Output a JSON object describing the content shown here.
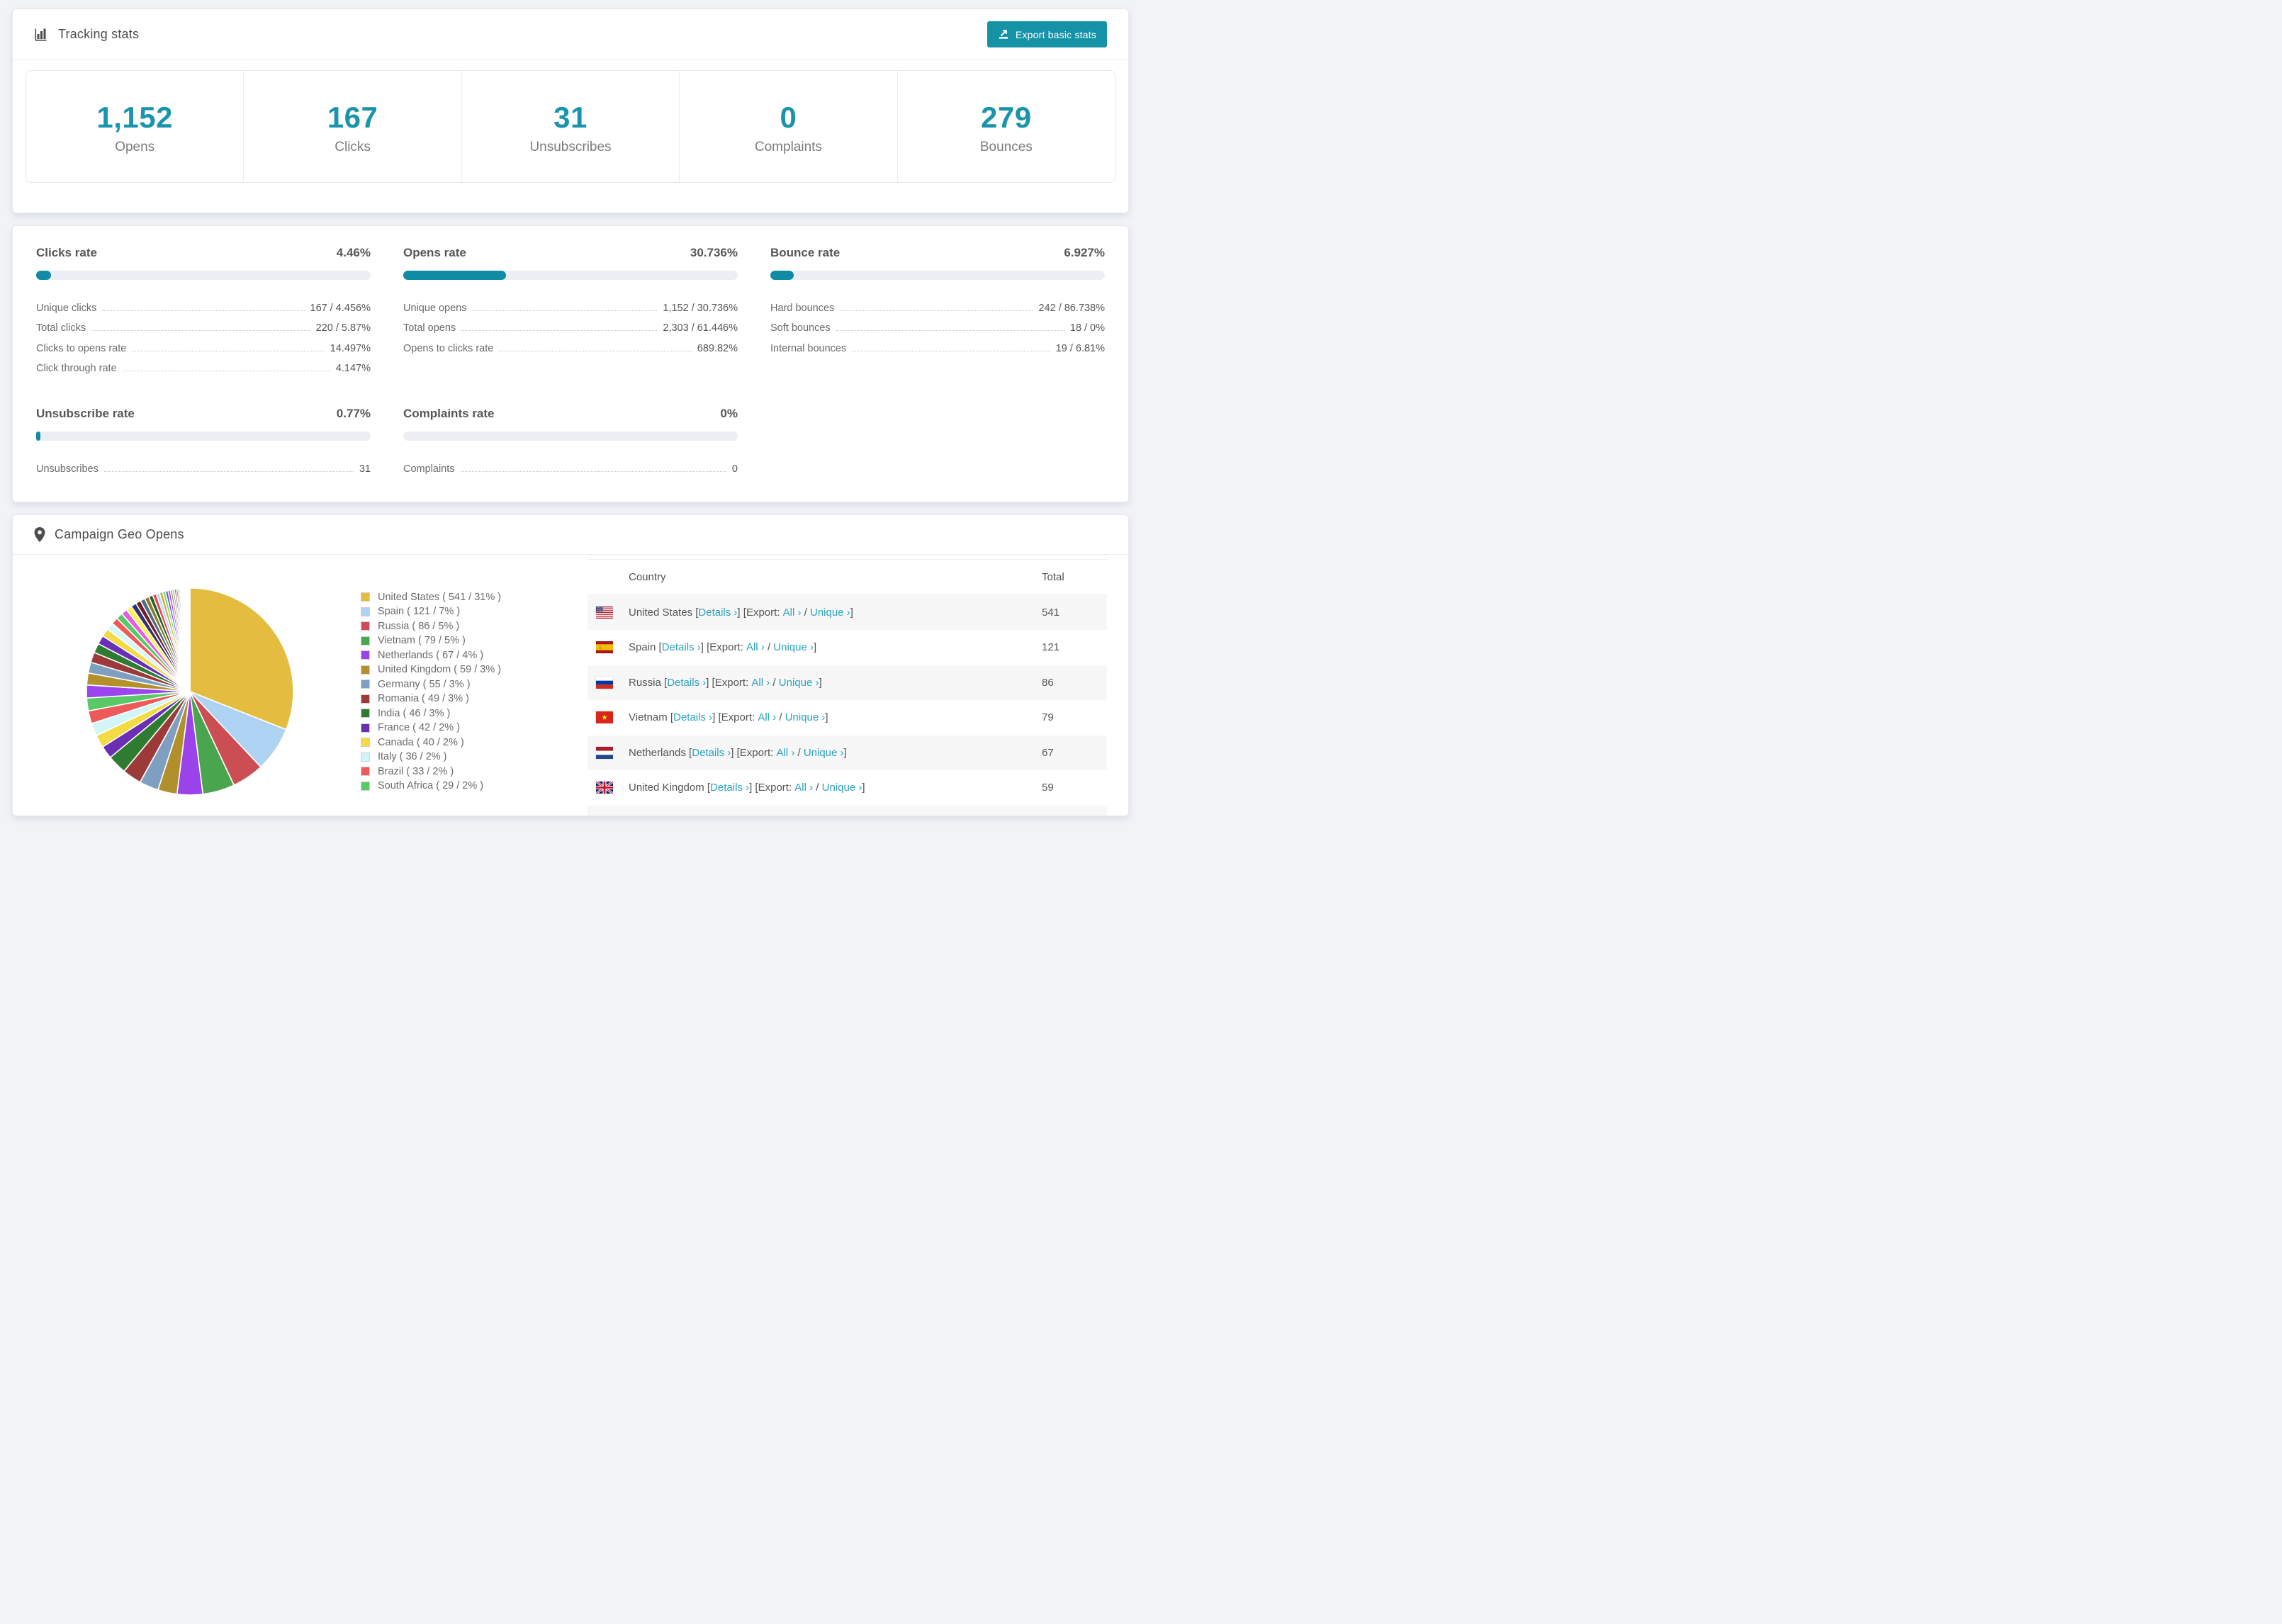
{
  "tracking": {
    "title": "Tracking stats",
    "export_label": "Export basic stats",
    "stats": [
      {
        "value": "1,152",
        "label": "Opens"
      },
      {
        "value": "167",
        "label": "Clicks"
      },
      {
        "value": "31",
        "label": "Unsubscribes"
      },
      {
        "value": "0",
        "label": "Complaints"
      },
      {
        "value": "279",
        "label": "Bounces"
      }
    ]
  },
  "rates": {
    "blocks": [
      {
        "title": "Clicks rate",
        "value": "4.46%",
        "pct": 4.46,
        "rows": [
          [
            "Unique clicks",
            "167 / 4.456%"
          ],
          [
            "Total clicks",
            "220 / 5.87%"
          ],
          [
            "Clicks to opens rate",
            "14.497%"
          ],
          [
            "Click through rate",
            "4.147%"
          ]
        ]
      },
      {
        "title": "Opens rate",
        "value": "30.736%",
        "pct": 30.736,
        "rows": [
          [
            "Unique opens",
            "1,152 / 30.736%"
          ],
          [
            "Total opens",
            "2,303 / 61.446%"
          ],
          [
            "Opens to clicks rate",
            "689.82%"
          ]
        ]
      },
      {
        "title": "Bounce rate",
        "value": "6.927%",
        "pct": 6.927,
        "rows": [
          [
            "Hard bounces",
            "242 / 86.738%"
          ],
          [
            "Soft bounces",
            "18 / 0%"
          ],
          [
            "Internal bounces",
            "19 / 6.81%"
          ]
        ]
      },
      {
        "title": "Unsubscribe rate",
        "value": "0.77%",
        "pct": 0.77,
        "rows": [
          [
            "Unsubscribes",
            "31"
          ]
        ]
      },
      {
        "title": "Complaints rate",
        "value": "0%",
        "pct": 0,
        "rows": [
          [
            "Complaints",
            "0"
          ]
        ]
      }
    ]
  },
  "geo": {
    "title": "Campaign Geo Opens",
    "table_headers": {
      "country": "Country",
      "total": "Total"
    },
    "link_labels": {
      "details": "Details ›",
      "export_prefix": "Export:",
      "all": "All ›",
      "unique": "Unique ›"
    },
    "table_visible_rows": 7,
    "countries": [
      {
        "name": "United States",
        "count": 541,
        "pct": 31,
        "color": "#e4bc40",
        "flag": "us",
        "total": "541"
      },
      {
        "name": "Spain",
        "count": 121,
        "pct": 7,
        "color": "#aed3f2",
        "flag": "es",
        "total": "121"
      },
      {
        "name": "Russia",
        "count": 86,
        "pct": 5,
        "color": "#cb4e55",
        "flag": "ru",
        "total": "86"
      },
      {
        "name": "Vietnam",
        "count": 79,
        "pct": 5,
        "color": "#4aa64e",
        "flag": "vn",
        "total": "79"
      },
      {
        "name": "Netherlands",
        "count": 67,
        "pct": 4,
        "color": "#9a43ea",
        "flag": "nl",
        "total": "67"
      },
      {
        "name": "United Kingdom",
        "count": 59,
        "pct": 3,
        "color": "#b18f2c",
        "flag": "gb",
        "total": "59"
      },
      {
        "name": "Germany",
        "count": 55,
        "pct": 3,
        "color": "#7e9fbf",
        "flag": "de",
        "total": "55"
      },
      {
        "name": "Romania",
        "count": 49,
        "pct": 3,
        "color": "#9c3a3a",
        "flag": "ro",
        "total": "49"
      },
      {
        "name": "India",
        "count": 46,
        "pct": 3,
        "color": "#2e7c32",
        "flag": "in",
        "total": "46"
      },
      {
        "name": "France",
        "count": 42,
        "pct": 2,
        "color": "#6a2fb5",
        "flag": "fr",
        "total": "42"
      },
      {
        "name": "Canada",
        "count": 40,
        "pct": 2,
        "color": "#f4da43",
        "flag": "ca",
        "total": "40"
      },
      {
        "name": "Italy",
        "count": 36,
        "pct": 2,
        "color": "#d2f6f8",
        "flag": "it",
        "total": "36"
      },
      {
        "name": "Brazil",
        "count": 33,
        "pct": 2,
        "color": "#ee5a5a",
        "flag": "br",
        "total": "33"
      },
      {
        "name": "South Africa",
        "count": 29,
        "pct": 2,
        "color": "#57c967",
        "flag": "za",
        "total": "29"
      }
    ]
  },
  "chart_data": {
    "type": "pie",
    "title": "Campaign Geo Opens",
    "labels": [
      "United States",
      "Spain",
      "Russia",
      "Vietnam",
      "Netherlands",
      "United Kingdom",
      "Germany",
      "Romania",
      "India",
      "France",
      "Canada",
      "Italy",
      "Brazil",
      "South Africa"
    ],
    "values": [
      541,
      121,
      86,
      79,
      67,
      59,
      55,
      49,
      46,
      42,
      40,
      36,
      33,
      29
    ],
    "percents": [
      31,
      7,
      5,
      5,
      4,
      3,
      3,
      3,
      3,
      2,
      2,
      2,
      2,
      2
    ],
    "colors": [
      "#e4bc40",
      "#aed3f2",
      "#cb4e55",
      "#4aa64e",
      "#9a43ea",
      "#b18f2c",
      "#7e9fbf",
      "#9c3a3a",
      "#2e7c32",
      "#6a2fb5",
      "#f4da43",
      "#d2f6f8",
      "#ee5a5a",
      "#57c967"
    ],
    "start_angle_deg": 0,
    "direction": "clockwise",
    "legend_position": "right",
    "other_slices_note": "remaining ~26% split across many small unlabeled countries, decreasing size",
    "tail_weights": [
      1.9,
      1.75,
      1.6,
      1.5,
      1.4,
      1.3,
      1.2,
      1.1,
      1.0,
      0.95,
      0.9,
      0.85,
      0.8,
      0.75,
      0.7,
      0.65,
      0.6,
      0.55,
      0.5,
      0.46,
      0.42,
      0.38,
      0.35,
      0.32,
      0.29,
      0.26,
      0.24,
      0.22,
      0.2,
      0.18,
      0.16,
      0.14,
      0.12,
      0.11,
      0.1,
      0.09,
      0.08,
      0.07,
      0.06,
      0.05,
      0.05,
      0.04,
      0.04,
      0.03,
      0.03
    ],
    "tail_palette": [
      "#9b44ef",
      "#b2902c",
      "#7e9fbf",
      "#9c3a3a",
      "#2e7c32",
      "#6a2fb5",
      "#f4da43",
      "#d8f7f9",
      "#ee5a5a",
      "#57c967",
      "#e85ce0",
      "#fdf24e",
      "#35306e",
      "#6e1f2a",
      "#4a6c85",
      "#8a7a24",
      "#235c2d",
      "#e8474f",
      "#bcd9f5",
      "#d3a62e",
      "#5ee86f",
      "#7a3bf0"
    ]
  }
}
